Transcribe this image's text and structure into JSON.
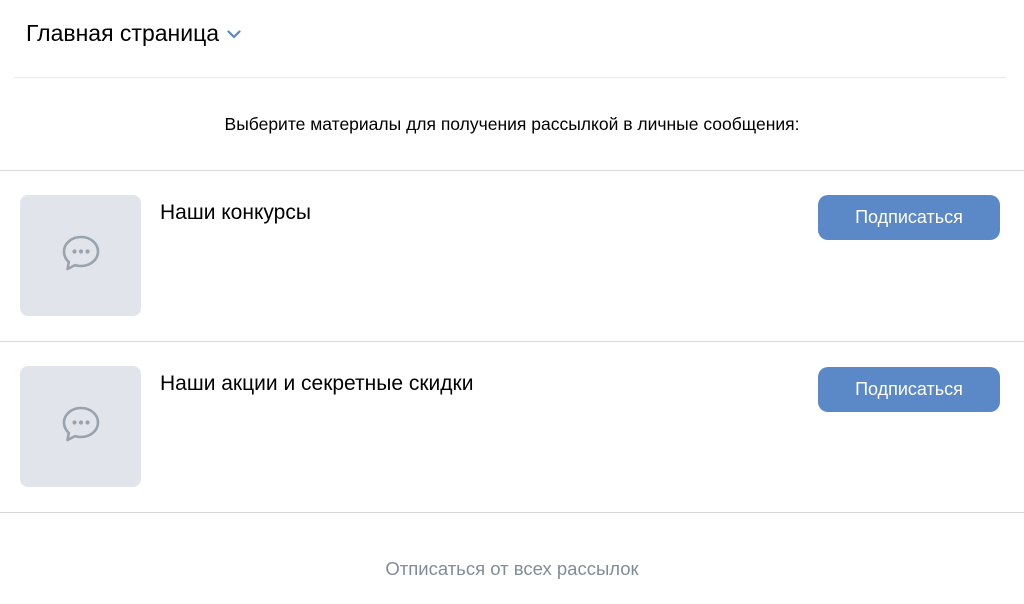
{
  "header": {
    "title": "Главная страница",
    "dropdown_icon": "chevron-down-icon"
  },
  "subtitle": "Выберите материалы для получения рассылкой в личные сообщения:",
  "items": [
    {
      "title": "Наши конкурсы",
      "button_label": "Подписаться",
      "thumb_icon": "message-bubble-icon"
    },
    {
      "title": "Наши акции и секретные скидки",
      "button_label": "Подписаться",
      "thumb_icon": "message-bubble-icon"
    }
  ],
  "footer": {
    "unsubscribe_all": "Отписаться от всех рассылок"
  },
  "colors": {
    "accent": "#5b88c6",
    "thumb_bg": "#e1e5eb",
    "muted_text": "#818c99",
    "divider": "#d7d8db"
  }
}
